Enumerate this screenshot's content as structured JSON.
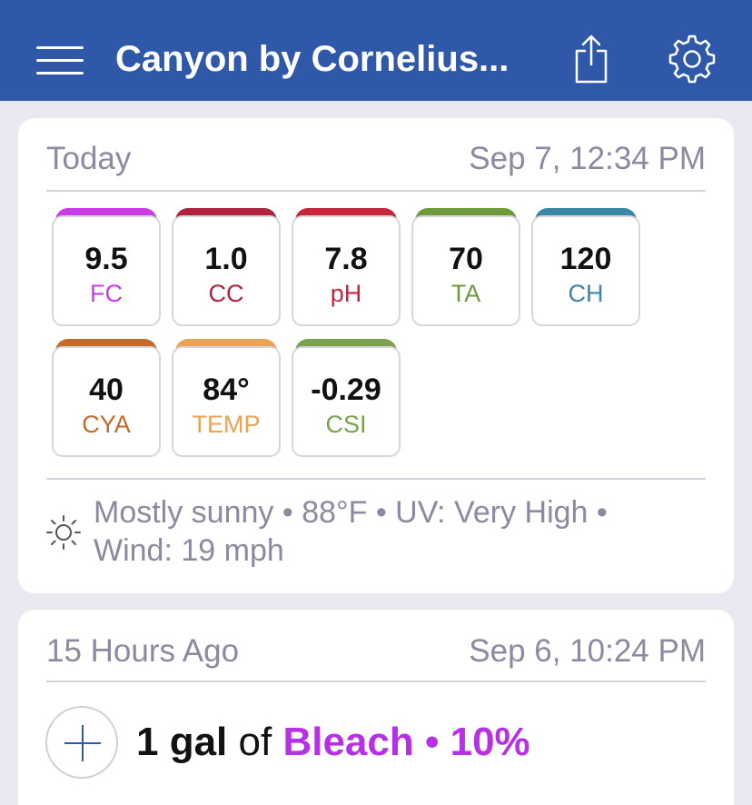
{
  "header": {
    "title": "Canyon by Cornelius...",
    "menu_icon": "hamburger-menu-icon",
    "share_icon": "share-icon",
    "settings_icon": "gear-icon",
    "background_color": "#3058a8"
  },
  "today_card": {
    "label": "Today",
    "timestamp": "Sep 7, 12:34 PM",
    "readings": [
      {
        "value": "9.5",
        "label": "FC",
        "color": "#c93ce6"
      },
      {
        "value": "1.0",
        "label": "CC",
        "color": "#b0233e"
      },
      {
        "value": "7.8",
        "label": "pH",
        "color": "#c8253a"
      },
      {
        "value": "70",
        "label": "TA",
        "color": "#6f9a3a"
      },
      {
        "value": "120",
        "label": "CH",
        "color": "#3a86a6"
      },
      {
        "value": "40",
        "label": "CYA",
        "color": "#c46a2a"
      },
      {
        "value": "84°",
        "label": "TEMP",
        "color": "#eba254"
      },
      {
        "value": "-0.29",
        "label": "CSI",
        "color": "#7aa24e"
      }
    ],
    "weather": {
      "icon": "sun-icon",
      "line1": "Mostly sunny • 88°F • UV: Very High •",
      "line2": "Wind: 19 mph"
    }
  },
  "earlier_card": {
    "label": "15 Hours Ago",
    "timestamp": "Sep 6, 10:24 PM",
    "entry": {
      "add_icon": "plus-icon",
      "quantity": "1 gal",
      "of": "of",
      "chemical": "Bleach • 10%",
      "chemical_color": "#b630e6"
    }
  }
}
